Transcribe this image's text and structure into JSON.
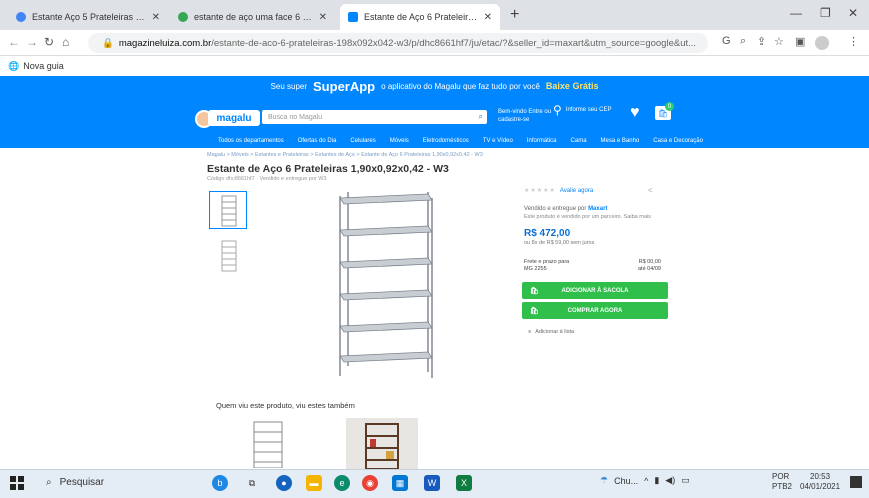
{
  "browser": {
    "tabs": [
      {
        "title": "Estante Aço 5 Prateleiras Com 1,...",
        "favicon": "google-icon",
        "active": false
      },
      {
        "title": "estante de aço uma face 6 prate...",
        "favicon": "google-icon",
        "active": false
      },
      {
        "title": "Estante de Aço 6 Prateleiras 1,90...",
        "favicon": "magalu-icon",
        "active": true
      }
    ],
    "new_tab": "+",
    "url_domain": "magazineluiza.com.br",
    "url_path": "/estante-de-aco-6-prateleiras-198x092x042-w3/p/dhc8661hf7/ju/etac/?&seller_id=maxart&utm_source=google&ut...",
    "bookmark": "Nova guia"
  },
  "site": {
    "promo_text": "Seu super",
    "promo_brand": "SuperApp",
    "promo_middle": "o aplicativo do Magalu que faz tudo por você",
    "promo_cta": "Baixe Grátis",
    "logo": "magalu",
    "search_placeholder": "Busca no Magalu",
    "delivery_label": "Bem-vindo Entre ou cadastre-se",
    "cep_label": "Informe seu CEP",
    "cart_count": "0",
    "categories": [
      "Todos os departamentos",
      "Ofertas do Dia",
      "Celulares",
      "Móveis",
      "Eletrodomésticos",
      "TV e Vídeo",
      "Informática",
      "Cama",
      "Mesa e Banho",
      "Casa e Decoração"
    ],
    "breadcrumb": "Magalu > Móveis > Estantes e Prateleiras > Estantes de Aço > Estante de Aço 6 Prateleiras 1,90x0,92x0,42 - W3"
  },
  "product": {
    "title": "Estante de Aço 6 Prateleiras 1,90x0,92x0,42 - W3",
    "code": "Código dhc8661hf7 · Vendido e entregue por W3",
    "rating_link": "Avalie agora",
    "seller_prefix": "Vendido e entregue por",
    "seller_name": "Maxart",
    "seller_note": "Este produto é vendido por um parceiro. Saiba mais",
    "price": "R$ 472,00",
    "installments": "ou 8x de R$ 59,00 sem juros",
    "frete_left": "Frete e prazo para\nMG 2255",
    "frete_right": "R$ 00,00\naté 04/09",
    "buy_button": "ADICIONAR À SACOLA",
    "buy_now_button": "COMPRAR AGORA",
    "list_link": "Adicionar à lista"
  },
  "also_viewed_title": "Quem viu este produto, viu estes também",
  "taskbar": {
    "search": "Pesquisar",
    "tray_text": "Chu...",
    "lang": "POR\nPTB2",
    "time": "20:53",
    "date": "04/01/2021"
  },
  "colors": {
    "brand_blue": "#0086ff",
    "buy_green": "#2fbf4a",
    "price_blue": "#0a6fd4"
  }
}
